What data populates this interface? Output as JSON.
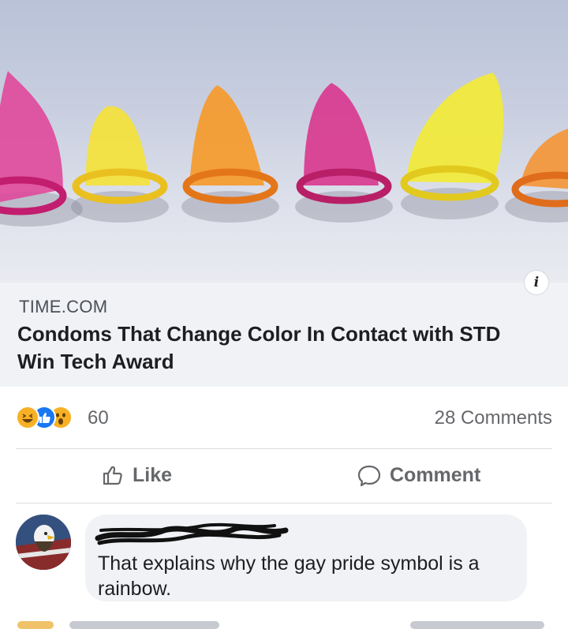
{
  "post": {
    "link_preview": {
      "image_icon": "condom-row-image",
      "info_icon": "info-icon",
      "info_glyph": "i",
      "domain": "TIME.COM",
      "title": "Condoms That Change Color In Contact with STD Win Tech Award"
    },
    "reactions": {
      "icons": [
        "haha-reaction-icon",
        "like-reaction-icon",
        "wow-reaction-icon"
      ],
      "count": "60"
    },
    "comments_count_label": "28 Comments",
    "actions": {
      "like_label": "Like",
      "comment_label": "Comment"
    }
  },
  "comment": {
    "author_name": "",
    "text": "That explains why the gay pride symbol is a rainbow."
  },
  "colors": {
    "text_primary": "#1c1e21",
    "text_secondary": "#65676b",
    "bubble_bg": "#f0f2f5",
    "like_blue": "#1877f2",
    "reaction_yellow": "#f7b125"
  }
}
